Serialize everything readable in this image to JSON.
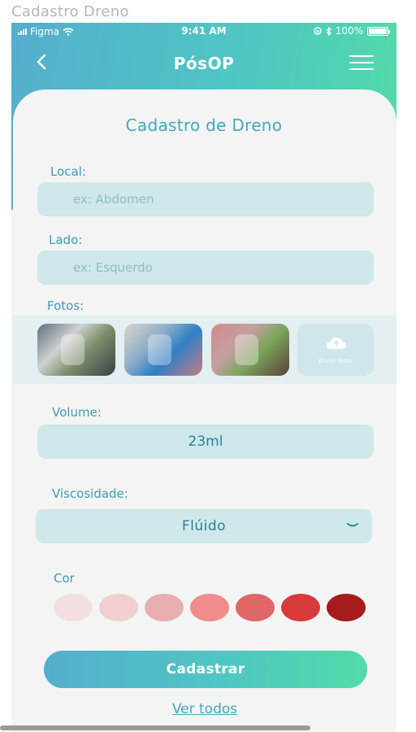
{
  "window": {
    "title": "Cadastro Dreno"
  },
  "status_bar": {
    "carrier": "Figma",
    "time": "9:41 AM",
    "battery": "100%",
    "battery_level": 1.0
  },
  "nav": {
    "title": "PósOP"
  },
  "form": {
    "title": "Cadastro de Dreno",
    "local": {
      "label": "Local:",
      "placeholder": "ex: Abdomen",
      "value": ""
    },
    "lado": {
      "label": "Lado:",
      "placeholder": "ex: Esquerdo",
      "value": ""
    },
    "fotos": {
      "label": "Fotos:",
      "upload_label": "Enviar fotos"
    },
    "volume": {
      "label": "Volume:",
      "value": "23ml"
    },
    "viscosidade": {
      "label": "Viscosidade:",
      "value": "Flúido"
    },
    "cor": {
      "label": "Cor",
      "swatches": [
        "#f4dfe0",
        "#f0cfd1",
        "#e8afb0",
        "#ef8c8c",
        "#e06767",
        "#d83a3a",
        "#a61b1b"
      ]
    },
    "submit_label": "Cadastrar",
    "see_all_label": "Ver todos"
  },
  "colors": {
    "accent": "#3fa9c2",
    "gradient_start": "#55aecd",
    "gradient_end": "#52dba8",
    "field_bg": "#cfe8ea"
  },
  "icons": [
    "signal-icon",
    "wifi-icon",
    "back-arrow-icon",
    "menu-icon",
    "cloud-upload-icon",
    "chevron-down-icon",
    "bluetooth-icon",
    "lock-rotation-icon",
    "battery-icon"
  ]
}
